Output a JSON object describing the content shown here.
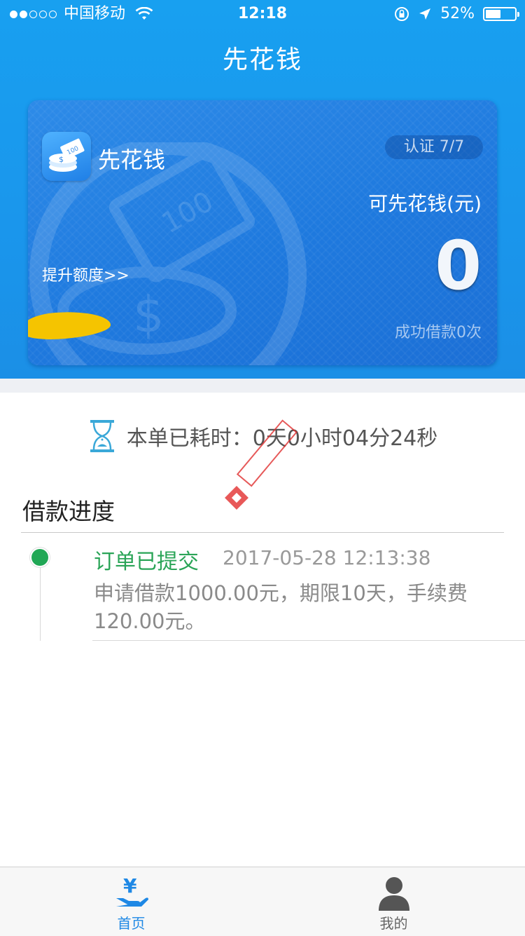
{
  "status_bar": {
    "carrier": "中国移动",
    "time": "12:18",
    "battery_percent": "52%",
    "battery_level": 0.52
  },
  "nav": {
    "title": "先花钱"
  },
  "card": {
    "app_name": "先花钱",
    "auth_badge": "认证 7/7",
    "available_label": "可先花钱(元)",
    "available_amount": "0",
    "raise_limit_link": "提升额度>>",
    "success_count": "成功借款0次"
  },
  "timer": {
    "text": "本单已耗时：0天0小时04分24秒"
  },
  "progress": {
    "title": "借款进度",
    "items": [
      {
        "status": "订单已提交",
        "time": "2017-05-28 12:13:38",
        "description": "申请借款1000.00元，期限10天，手续费120.00元。"
      }
    ]
  },
  "tabbar": {
    "tabs": [
      {
        "label": "首页",
        "icon": "yen-hand-icon",
        "active": true
      },
      {
        "label": "我的",
        "icon": "person-icon",
        "active": false
      }
    ]
  },
  "colors": {
    "primary_blue": "#1a96ec",
    "status_green": "#2aa457",
    "tab_active": "#1e88e5"
  }
}
